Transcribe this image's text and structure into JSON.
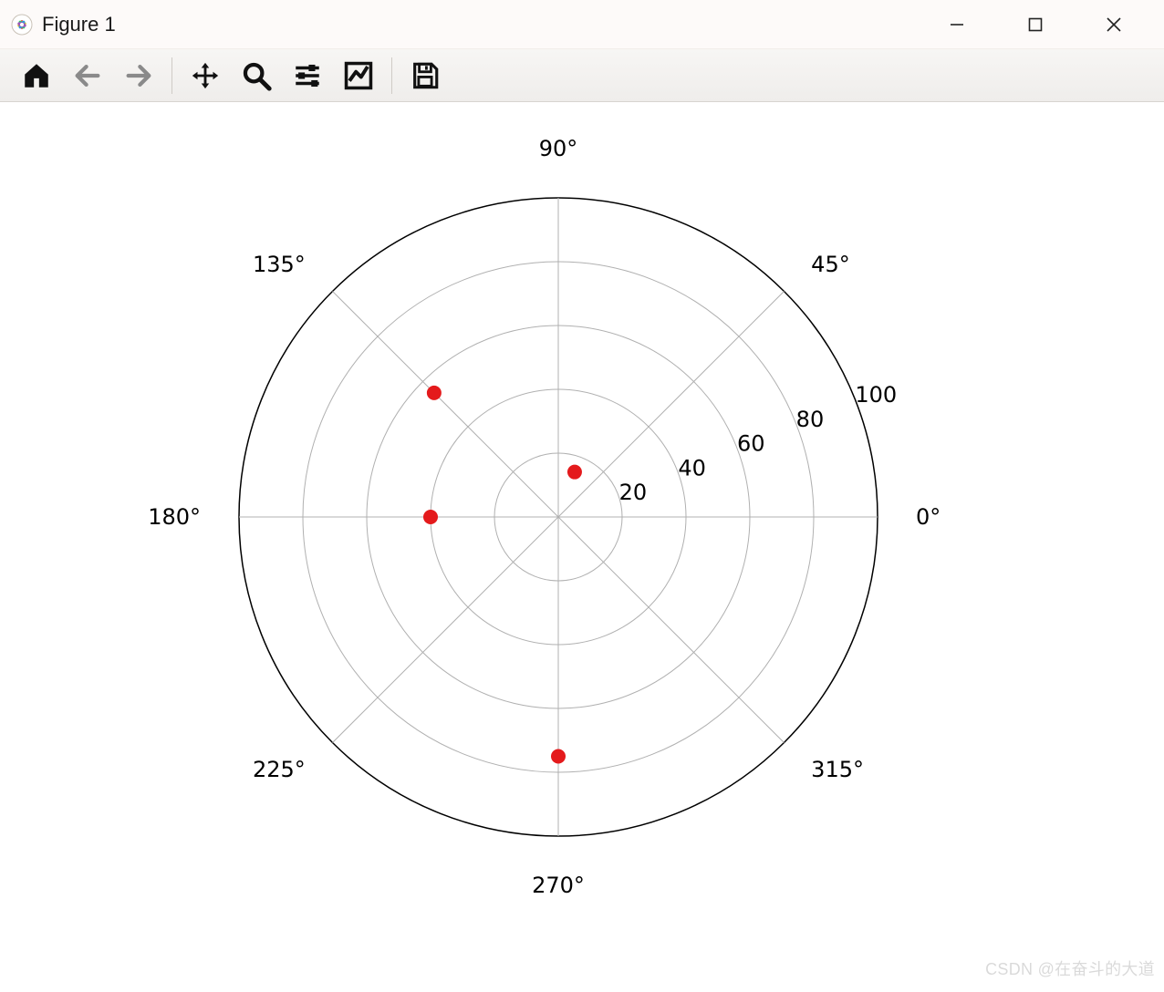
{
  "window": {
    "title": "Figure 1"
  },
  "toolbar": {
    "home": "Home",
    "back": "Back",
    "forward": "Forward",
    "pan": "Pan",
    "zoom": "Zoom",
    "configure": "Configure subplots",
    "edit": "Edit axis",
    "save": "Save"
  },
  "watermark": "CSDN @在奋斗的大道",
  "chart_data": {
    "type": "scatter",
    "polar": true,
    "title": "",
    "r_ticks": [
      20,
      40,
      60,
      80,
      100
    ],
    "r_tick_labels": [
      "20",
      "40",
      "60",
      "80",
      "100"
    ],
    "theta_ticks_deg": [
      0,
      45,
      90,
      135,
      180,
      225,
      270,
      315
    ],
    "theta_tick_labels": [
      "0°",
      "45°",
      "90°",
      "135°",
      "180°",
      "225°",
      "270°",
      "315°"
    ],
    "r_max": 100,
    "theta_zero": "E",
    "theta_direction": "ccw",
    "points": [
      {
        "theta_deg": 70,
        "r": 15
      },
      {
        "theta_deg": 135,
        "r": 55
      },
      {
        "theta_deg": 180,
        "r": 40
      },
      {
        "theta_deg": 270,
        "r": 75
      }
    ],
    "marker": {
      "color": "#e41a1c",
      "size": 8
    }
  }
}
